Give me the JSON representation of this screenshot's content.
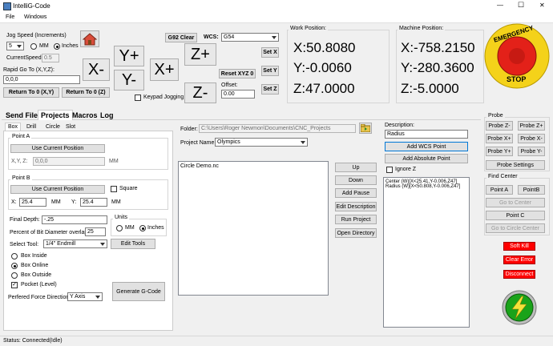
{
  "window": {
    "title": "IntelliG-Code",
    "minimize": "—",
    "maximize": "☐",
    "close": "✕"
  },
  "menu": {
    "items": [
      "File",
      "Windows"
    ]
  },
  "jog": {
    "speed_label": "Jog Speed (Increments)",
    "speed_value": "5",
    "mm_label": "MM",
    "inches_label": "Inches",
    "units_selected": "Inches",
    "current_speed_label": "CurrentSpeed:",
    "current_speed_value": "0.5",
    "rapid_label": "Rapid Go To (X,Y,Z):",
    "rapid_value": "0,0,0",
    "return_xy": "Return To 0 (X,Y)",
    "return_z": "Return To 0 (Z)",
    "xminus": "X-",
    "xplus": "X+",
    "yplus": "Y+",
    "yminus": "Y-",
    "zplus": "Z+",
    "zminus": "Z-",
    "keypad_label": "Keypad Jogging",
    "keypad_checked": false
  },
  "wcs": {
    "g92_clear": "G92 Clear",
    "wcs_label": "WCS:",
    "wcs_value": "G54",
    "set_x": "Set X",
    "set_y": "Set Y",
    "set_z": "Set Z",
    "reset_xyz": "Reset XYZ 0",
    "offset_label": "Offset:",
    "offset_value": "0.00"
  },
  "work_position": {
    "title": "Work Position:",
    "x": "X:50.8080",
    "y": "Y:-0.0060",
    "z": "Z:47.0000"
  },
  "machine_position": {
    "title": "Machine Position:",
    "x": "X:-758.2150",
    "y": "Y:-280.3600",
    "z": "Z:-5.0000"
  },
  "estop": {
    "top": "EMERGENCY",
    "bottom": "STOP"
  },
  "tabs": {
    "main": [
      "Send File",
      "Projects",
      "Macros",
      "Log"
    ],
    "main_active": "Projects",
    "sub": [
      "Box",
      "Drill",
      "Circle",
      "Slot"
    ],
    "sub_active": "Box"
  },
  "box": {
    "point_a_title": "Point A",
    "use_current_a": "Use Current Position",
    "xyz_label": "X,Y, Z:",
    "xyz_value": "0,0,0",
    "mm_unit": "MM",
    "point_b_title": "Point B",
    "use_current_b": "Use Current Position",
    "square_label": "Square",
    "square_checked": false,
    "x_label": "X:",
    "x_value": "25.4",
    "y_label": "Y:",
    "y_value": "25.4",
    "x_unit": "MM",
    "y_unit": "MM",
    "final_depth_label": "Final Depth:",
    "final_depth_value": "-.25",
    "overlap_label": "Percent of Bit Diameter overlap:",
    "overlap_value": "25",
    "units_title": "Units",
    "units_mm": "MM",
    "units_inches": "Inches",
    "units_selected": "Inches",
    "tool_label": "Select Tool:",
    "tool_value": "1/4\" Endmill",
    "edit_tools": "Edit Tools",
    "box_inside": "Box Inside",
    "box_online": "Box Online",
    "box_outside": "Box Outside",
    "box_selected": "Box Online",
    "pocket_label": "Pocket (Level)",
    "pocket_checked": true,
    "force_dir_label": "Perfered Force Direction:",
    "force_dir_value": "Y Axis",
    "generate": "Generate G-Code"
  },
  "project": {
    "folder_label": "Folder:",
    "folder_value": "C:\\Users\\Roger Newmon\\Documents\\CNC_Projects",
    "name_label": "Project Name:",
    "name_value": "Olympics",
    "files": [
      "Circle Demo.nc"
    ],
    "up": "Up",
    "down": "Down",
    "add_pause": "Add Pause",
    "edit_description": "Edit Description",
    "run_project": "Run Project",
    "open_directory": "Open Directory"
  },
  "description": {
    "label": "Description:",
    "value": "Radius",
    "add_wcs": "Add WCS Point",
    "add_absolute": "Add Absolute Point",
    "ignore_z": "Ignore Z",
    "ignore_z_checked": false,
    "lines": [
      "Center (W)[X<25.41,Y-0.006,Z47]",
      "Radius (W)[X<50.808,Y-0.006,Z47]"
    ]
  },
  "probe": {
    "title": "Probe",
    "z_minus": "Probe Z-",
    "z_plus": "Probe Z+",
    "x_plus": "Probe X+",
    "x_minus": "Probe X-",
    "y_plus": "Probe Y+",
    "y_minus": "Probe Y-",
    "settings": "Probe Settings"
  },
  "find_center": {
    "title": "Find Center",
    "point_a": "Point A",
    "point_b": "PointB",
    "go_to_center": "Go to Center",
    "point_c": "Point C",
    "go_to_circle_center": "Go to Circle Center"
  },
  "controls": {
    "soft_kill": "Soft Kill",
    "clear_error": "Clear Error",
    "disconnect": "Disconnect"
  },
  "status": {
    "text": "Status: Connected(Idle)"
  },
  "colors": {
    "estop_red": "#e32119",
    "estop_yellow": "#f4d21a",
    "kill_red": "#ff0000",
    "power_green": "#1aa31a"
  }
}
